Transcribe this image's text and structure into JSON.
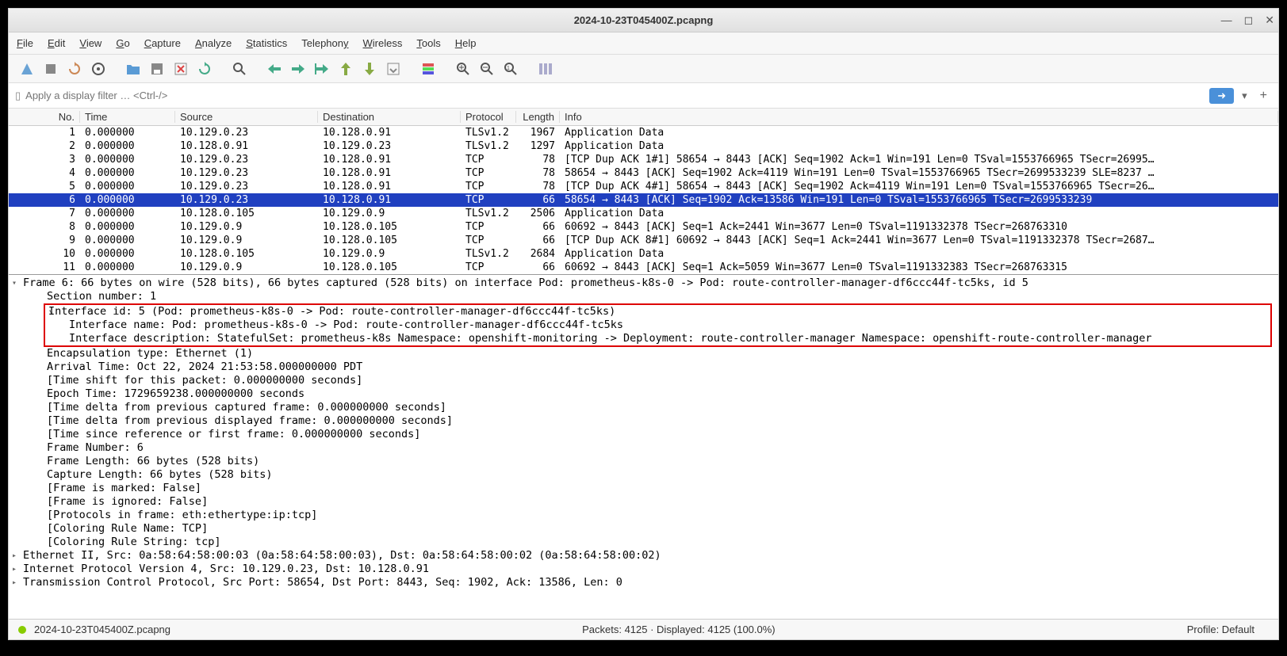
{
  "window": {
    "title": "2024-10-23T045400Z.pcapng"
  },
  "menu": [
    "File",
    "Edit",
    "View",
    "Go",
    "Capture",
    "Analyze",
    "Statistics",
    "Telephony",
    "Wireless",
    "Tools",
    "Help"
  ],
  "filter": {
    "placeholder": "Apply a display filter … <Ctrl-/>"
  },
  "columns": {
    "no": "No.",
    "time": "Time",
    "src": "Source",
    "dst": "Destination",
    "proto": "Protocol",
    "len": "Length",
    "info": "Info"
  },
  "packets": [
    {
      "no": "1",
      "time": "0.000000",
      "src": "10.129.0.23",
      "dst": "10.128.0.91",
      "proto": "TLSv1.2",
      "len": "1967",
      "info": "Application Data"
    },
    {
      "no": "2",
      "time": "0.000000",
      "src": "10.128.0.91",
      "dst": "10.129.0.23",
      "proto": "TLSv1.2",
      "len": "1297",
      "info": "Application Data"
    },
    {
      "no": "3",
      "time": "0.000000",
      "src": "10.129.0.23",
      "dst": "10.128.0.91",
      "proto": "TCP",
      "len": "78",
      "info": "[TCP Dup ACK 1#1] 58654 → 8443 [ACK] Seq=1902 Ack=1 Win=191 Len=0 TSval=1553766965 TSecr=26995…"
    },
    {
      "no": "4",
      "time": "0.000000",
      "src": "10.129.0.23",
      "dst": "10.128.0.91",
      "proto": "TCP",
      "len": "78",
      "info": "58654 → 8443 [ACK] Seq=1902 Ack=4119 Win=191 Len=0 TSval=1553766965 TSecr=2699533239 SLE=8237 …"
    },
    {
      "no": "5",
      "time": "0.000000",
      "src": "10.129.0.23",
      "dst": "10.128.0.91",
      "proto": "TCP",
      "len": "78",
      "info": "[TCP Dup ACK 4#1] 58654 → 8443 [ACK] Seq=1902 Ack=4119 Win=191 Len=0 TSval=1553766965 TSecr=26…"
    },
    {
      "no": "6",
      "time": "0.000000",
      "src": "10.129.0.23",
      "dst": "10.128.0.91",
      "proto": "TCP",
      "len": "66",
      "info": "58654 → 8443 [ACK] Seq=1902 Ack=13586 Win=191 Len=0 TSval=1553766965 TSecr=2699533239",
      "selected": true
    },
    {
      "no": "7",
      "time": "0.000000",
      "src": "10.128.0.105",
      "dst": "10.129.0.9",
      "proto": "TLSv1.2",
      "len": "2506",
      "info": "Application Data"
    },
    {
      "no": "8",
      "time": "0.000000",
      "src": "10.129.0.9",
      "dst": "10.128.0.105",
      "proto": "TCP",
      "len": "66",
      "info": "60692 → 8443 [ACK] Seq=1 Ack=2441 Win=3677 Len=0 TSval=1191332378 TSecr=268763310"
    },
    {
      "no": "9",
      "time": "0.000000",
      "src": "10.129.0.9",
      "dst": "10.128.0.105",
      "proto": "TCP",
      "len": "66",
      "info": "[TCP Dup ACK 8#1] 60692 → 8443 [ACK] Seq=1 Ack=2441 Win=3677 Len=0 TSval=1191332378 TSecr=2687…"
    },
    {
      "no": "10",
      "time": "0.000000",
      "src": "10.128.0.105",
      "dst": "10.129.0.9",
      "proto": "TLSv1.2",
      "len": "2684",
      "info": "Application Data"
    },
    {
      "no": "11",
      "time": "0.000000",
      "src": "10.129.0.9",
      "dst": "10.128.0.105",
      "proto": "TCP",
      "len": "66",
      "info": "60692 → 8443 [ACK] Seq=1 Ack=5059 Win=3677 Len=0 TSval=1191332383 TSecr=268763315"
    }
  ],
  "details": {
    "frame": "Frame 6: 66 bytes on wire (528 bits), 66 bytes captured (528 bits) on interface Pod: prometheus-k8s-0 -> Pod: route-controller-manager-df6ccc44f-tc5ks, id 5",
    "section": "Section number: 1",
    "iface_id": "Interface id: 5 (Pod: prometheus-k8s-0 -> Pod: route-controller-manager-df6ccc44f-tc5ks)",
    "iface_name": "Interface name: Pod: prometheus-k8s-0 -> Pod: route-controller-manager-df6ccc44f-tc5ks",
    "iface_desc": "Interface description: StatefulSet: prometheus-k8s Namespace: openshift-monitoring -> Deployment: route-controller-manager Namespace: openshift-route-controller-manager",
    "encap": "Encapsulation type: Ethernet (1)",
    "arrival": "Arrival Time: Oct 22, 2024 21:53:58.000000000 PDT",
    "shift": "[Time shift for this packet: 0.000000000 seconds]",
    "epoch": "Epoch Time: 1729659238.000000000 seconds",
    "delta_cap": "[Time delta from previous captured frame: 0.000000000 seconds]",
    "delta_disp": "[Time delta from previous displayed frame: 0.000000000 seconds]",
    "since_ref": "[Time since reference or first frame: 0.000000000 seconds]",
    "frame_num": "Frame Number: 6",
    "frame_len": "Frame Length: 66 bytes (528 bits)",
    "cap_len": "Capture Length: 66 bytes (528 bits)",
    "marked": "[Frame is marked: False]",
    "ignored": "[Frame is ignored: False]",
    "protos": "[Protocols in frame: eth:ethertype:ip:tcp]",
    "color_name": "[Coloring Rule Name: TCP]",
    "color_str": "[Coloring Rule String: tcp]",
    "eth": "Ethernet II, Src: 0a:58:64:58:00:03 (0a:58:64:58:00:03), Dst: 0a:58:64:58:00:02 (0a:58:64:58:00:02)",
    "ip": "Internet Protocol Version 4, Src: 10.129.0.23, Dst: 10.128.0.91",
    "tcp": "Transmission Control Protocol, Src Port: 58654, Dst Port: 8443, Seq: 1902, Ack: 13586, Len: 0"
  },
  "status": {
    "file": "2024-10-23T045400Z.pcapng",
    "packets": "Packets: 4125 · Displayed: 4125 (100.0%)",
    "profile": "Profile: Default"
  }
}
